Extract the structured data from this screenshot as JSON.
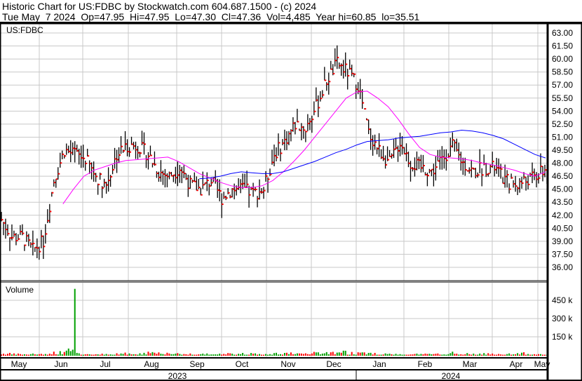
{
  "header": {
    "line1": "Historic Chart for US:FDBC by Stockwatch.com 604.687.1500 - (c) 2024",
    "line2": "Tue May  7 2024  Op=47.95  Hi=47.95  Lo=47.30  Cl=47.36  Vol=4,485  Year hi=60.85  lo=35.51"
  },
  "chart_data": {
    "type": "line",
    "title": "US:FDBC",
    "price_ticks": [
      "63.00",
      "61.50",
      "60.00",
      "58.50",
      "57.00",
      "55.50",
      "54.00",
      "52.50",
      "51.00",
      "49.50",
      "48.00",
      "46.50",
      "45.00",
      "43.50",
      "42.00",
      "40.50",
      "39.00",
      "37.50",
      "36.00"
    ],
    "ylim": [
      35,
      63.5
    ],
    "volume_label": "Volume",
    "volume_ticks": [
      "450 k",
      "300 k",
      "150 k"
    ],
    "volume_tick_values": [
      450000,
      300000,
      150000
    ],
    "months": [
      "May",
      "Jun",
      "Jul",
      "Aug",
      "Sep",
      "Oct",
      "Nov",
      "Dec",
      "Jan",
      "Feb",
      "Mar",
      "Apr",
      "May"
    ],
    "years": [
      "2023",
      "2024"
    ],
    "weekly_close": [
      41.5,
      39.5,
      39.5,
      38,
      39,
      46,
      49.5,
      49,
      48.5,
      46.5,
      45.5,
      49,
      50,
      50,
      49,
      47,
      46.5,
      47.5,
      45.5,
      45,
      46,
      44,
      45,
      45,
      44.5,
      45,
      49,
      50.5,
      52.5,
      52,
      54.5,
      57.5,
      59.5,
      58.5,
      57,
      51.5,
      49.5,
      48,
      50.5,
      48,
      47.5,
      47,
      48.5,
      50,
      48,
      47,
      47.5,
      47.5,
      46,
      45.5,
      46,
      46.5,
      47.36
    ],
    "ma_short": [
      null,
      null,
      null,
      null,
      null,
      null,
      43.3,
      45,
      46.5,
      47.2,
      47.6,
      48,
      48.3,
      48.4,
      48.5,
      48.6,
      48.7,
      48.2,
      47.5,
      46.8,
      46.3,
      45.8,
      45.4,
      45.2,
      45.2,
      45.4,
      46,
      47,
      48.2,
      49.5,
      51,
      52.5,
      54,
      55.5,
      56.2,
      56.3,
      55.5,
      54.5,
      53,
      51.3,
      49.8,
      49,
      48.7,
      48.6,
      48.5,
      48.3,
      48,
      47.8,
      47.5,
      47.2,
      46.8,
      46.5,
      47
    ],
    "ma_long": [
      null,
      null,
      null,
      null,
      null,
      null,
      null,
      null,
      null,
      null,
      null,
      null,
      null,
      null,
      null,
      null,
      null,
      null,
      null,
      46.2,
      46.3,
      46.5,
      46.8,
      47,
      46.9,
      46.8,
      46.8,
      47,
      47.4,
      47.8,
      48.2,
      48.7,
      49.2,
      49.6,
      50.1,
      50.5,
      50.6,
      50.7,
      50.9,
      51,
      51.1,
      51.3,
      51.5,
      51.6,
      51.8,
      51.7,
      51.5,
      51.2,
      50.8,
      50.2,
      49.6,
      49,
      48.6
    ],
    "weekly_volume": [
      15000,
      12000,
      10000,
      14000,
      12000,
      25000,
      40000,
      550000,
      15000,
      12000,
      10000,
      18000,
      12000,
      22000,
      30000,
      20000,
      14000,
      12000,
      16000,
      12000,
      14000,
      18000,
      12000,
      16000,
      14000,
      12000,
      16000,
      18000,
      14000,
      20000,
      22000,
      25000,
      30000,
      20000,
      18000,
      16000,
      14000,
      12000,
      15000,
      14000,
      12000,
      14000,
      18000,
      22000,
      14000,
      12000,
      14000,
      12000,
      16000,
      18000,
      14000,
      12000,
      8000
    ],
    "colors": {
      "bar": "#000000",
      "close_tick": "#ff0000",
      "ma_short": "#ff00ff",
      "ma_long": "#0000ff",
      "vol_up": "#00a000",
      "vol_down": "#ff0000",
      "grid": "#c8c8c8"
    }
  }
}
